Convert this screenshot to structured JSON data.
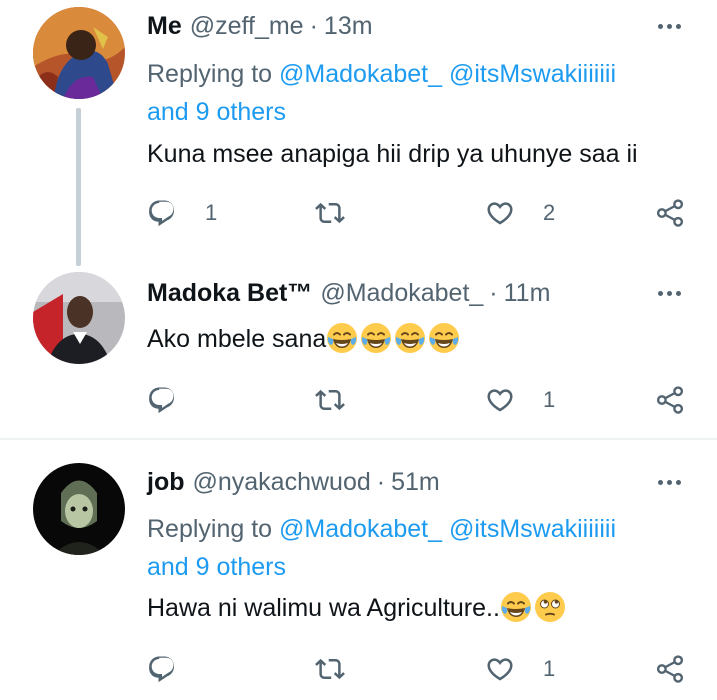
{
  "tweets": [
    {
      "name": "Me",
      "handle": "@zeff_me",
      "separator": "·",
      "time": "13m",
      "replying_prefix": "Replying to ",
      "mentions": [
        "@Madokabet_",
        "@itsMswakiiiiiii"
      ],
      "and_others": "and 9 others",
      "text": "Kuna msee anapiga hii drip ya uhunye saa ii",
      "reply_count": "1",
      "retweet_count": "",
      "like_count": "2"
    },
    {
      "name": "Madoka Bet™",
      "handle": "@Madokabet_",
      "separator": "·",
      "time": "11m",
      "text": "Ako mbele sana",
      "emojis": [
        "face-with-tears-of-joy",
        "face-with-tears-of-joy",
        "face-with-tears-of-joy",
        "face-with-tears-of-joy"
      ],
      "reply_count": "",
      "retweet_count": "",
      "like_count": "1"
    },
    {
      "name": "job",
      "handle": "@nyakachwuod",
      "separator": "·",
      "time": "51m",
      "replying_prefix": "Replying to ",
      "mentions": [
        "@Madokabet_",
        "@itsMswakiiiiiii"
      ],
      "and_others": "and 9 others",
      "text": "Hawa ni walimu wa Agriculture..",
      "emojis": [
        "face-with-tears-of-joy",
        "face-with-rolling-eyes"
      ],
      "reply_count": "",
      "retweet_count": "",
      "like_count": "1"
    }
  ],
  "colors": {
    "link": "#1d9bf0",
    "secondary": "#536471",
    "primary": "#0f1419",
    "thread_line": "#c4cfd6",
    "divider": "#eff3f4"
  },
  "icons": [
    "reply-icon",
    "retweet-icon",
    "like-icon",
    "share-icon",
    "more-icon"
  ]
}
